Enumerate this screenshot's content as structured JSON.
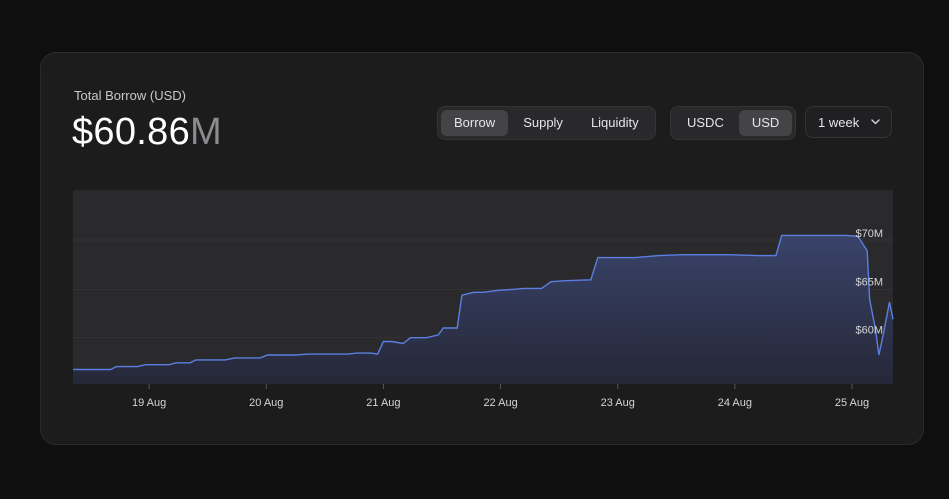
{
  "header": {
    "title": "Total Borrow (USD)",
    "value": "$60.86",
    "value_unit": "M"
  },
  "metric_toggle": {
    "options": [
      "Borrow",
      "Supply",
      "Liquidity"
    ],
    "selected": "Borrow"
  },
  "currency_toggle": {
    "options": [
      "USDC",
      "USD"
    ],
    "selected": "USD"
  },
  "range_select": {
    "value": "1 week",
    "icon": "chevron-down-icon"
  },
  "colors": {
    "line": "#5b7fe0",
    "area_top": "#39436a",
    "area_bottom": "#262838",
    "plot_bg": "#2a2a2c"
  },
  "chart_data": {
    "type": "area",
    "title": "",
    "xlabel": "",
    "ylabel": "",
    "x_ticks": [
      {
        "label": "19 Aug",
        "day": 18.65
      },
      {
        "label": "20 Aug",
        "day": 19.65
      },
      {
        "label": "21 Aug",
        "day": 20.65
      },
      {
        "label": "22 Aug",
        "day": 21.65
      },
      {
        "label": "23 Aug",
        "day": 22.65
      },
      {
        "label": "24 Aug",
        "day": 23.65
      },
      {
        "label": "25 Aug",
        "day": 24.65
      }
    ],
    "y_ticks": [
      {
        "label": "$60M",
        "value": 60
      },
      {
        "label": "$65M",
        "value": 65
      },
      {
        "label": "$70M",
        "value": 70
      }
    ],
    "xlim": [
      18.0,
      25.0
    ],
    "ylim": [
      55.2,
      75.3
    ],
    "grid": true,
    "series": [
      {
        "x": [
          18.0,
          18.32,
          18.37,
          18.55,
          18.62,
          18.82,
          18.88,
          19.0,
          19.05,
          19.3,
          19.38,
          19.6,
          19.66,
          19.9,
          20.0,
          20.2,
          20.26,
          20.35,
          20.42,
          20.54,
          20.6,
          20.65,
          20.72,
          20.82,
          20.88,
          21.02,
          21.12,
          21.16,
          21.28,
          21.32,
          21.42,
          21.5,
          21.62,
          21.75,
          21.85,
          22.0,
          22.08,
          22.2,
          22.42,
          22.48,
          22.8,
          22.9,
          23.0,
          23.2,
          23.55,
          23.6,
          23.85,
          24.0,
          24.05,
          24.15,
          24.2,
          24.6,
          24.7,
          24.78,
          24.8,
          24.85,
          24.88,
          24.92,
          24.97,
          25.0
        ],
        "y": [
          56.7,
          56.7,
          57.0,
          57.0,
          57.2,
          57.2,
          57.4,
          57.4,
          57.7,
          57.7,
          57.9,
          57.9,
          58.2,
          58.2,
          58.3,
          58.3,
          58.3,
          58.3,
          58.4,
          58.4,
          58.3,
          59.6,
          59.6,
          59.4,
          60.0,
          60.0,
          60.3,
          61.0,
          61.0,
          64.4,
          64.7,
          64.7,
          64.9,
          65.0,
          65.1,
          65.1,
          65.8,
          65.9,
          66.0,
          68.3,
          68.3,
          68.4,
          68.5,
          68.6,
          68.6,
          68.6,
          68.5,
          68.5,
          70.6,
          70.6,
          70.6,
          70.6,
          70.5,
          69.0,
          64.0,
          60.9,
          58.2,
          60.5,
          63.7,
          61.9
        ]
      }
    ]
  }
}
